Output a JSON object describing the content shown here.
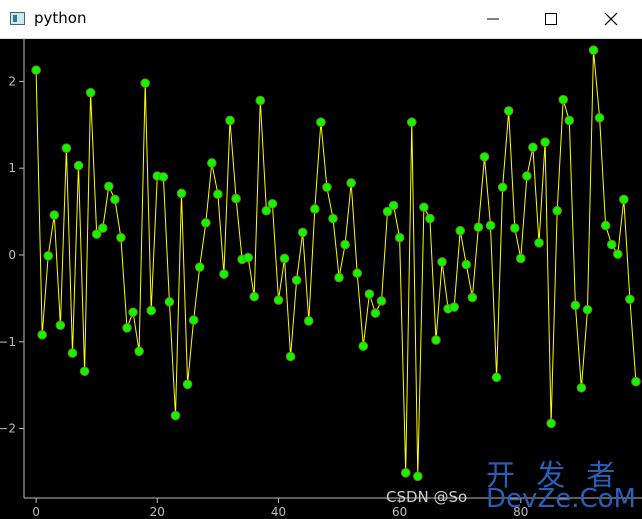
{
  "window": {
    "title": "python",
    "icon": "python-app-icon",
    "controls": [
      "minimize-icon",
      "maximize-icon",
      "close-icon"
    ]
  },
  "colors": {
    "background": "#000000",
    "line": "#ffff00",
    "marker_fill": "#00ff00",
    "marker_edge": "#8b8000",
    "axis": "#bdbdbd"
  },
  "chart_data": {
    "type": "line",
    "title": "",
    "xlabel": "",
    "ylabel": "",
    "xlim": [
      -2,
      100
    ],
    "ylim": [
      -2.8,
      2.5
    ],
    "xticks": [
      0,
      20,
      40,
      60,
      80
    ],
    "yticks": [
      -2,
      -1,
      0,
      1,
      2
    ],
    "series": [
      {
        "marker": "circle",
        "values": [
          2.13,
          -0.92,
          -0.01,
          0.46,
          -0.81,
          1.23,
          -1.13,
          1.03,
          -1.34,
          1.87,
          0.24,
          0.31,
          0.79,
          0.64,
          0.2,
          -0.84,
          -0.66,
          -1.11,
          1.98,
          -0.64,
          0.91,
          0.9,
          -0.54,
          -1.85,
          0.71,
          -1.49,
          -0.75,
          -0.14,
          0.37,
          1.06,
          0.7,
          -0.22,
          1.55,
          0.65,
          -0.05,
          -0.03,
          -0.48,
          1.78,
          0.51,
          0.59,
          -0.52,
          -0.04,
          -1.17,
          -0.29,
          0.26,
          -0.76,
          0.53,
          1.53,
          0.78,
          0.42,
          -0.26,
          0.12,
          0.83,
          -0.21,
          -1.05,
          -0.45,
          -0.67,
          -0.53,
          0.5,
          0.57,
          0.2,
          -2.51,
          1.53,
          -2.55,
          0.55,
          0.42,
          -0.98,
          -0.08,
          -0.62,
          -0.6,
          0.28,
          -0.11,
          -0.49,
          0.32,
          1.13,
          0.34,
          -1.41,
          0.78,
          1.66,
          0.31,
          -0.04,
          0.91,
          1.24,
          0.14,
          1.3,
          -1.94,
          0.51,
          1.79,
          1.55,
          -0.58,
          -1.53,
          -0.63,
          2.36,
          1.58,
          0.34,
          0.12,
          0.01,
          0.64,
          -0.51,
          -1.46
        ]
      }
    ]
  },
  "watermark": {
    "line1": "开 发 者",
    "line2": "DevZe.CoM",
    "credit": "CSDN @So"
  }
}
